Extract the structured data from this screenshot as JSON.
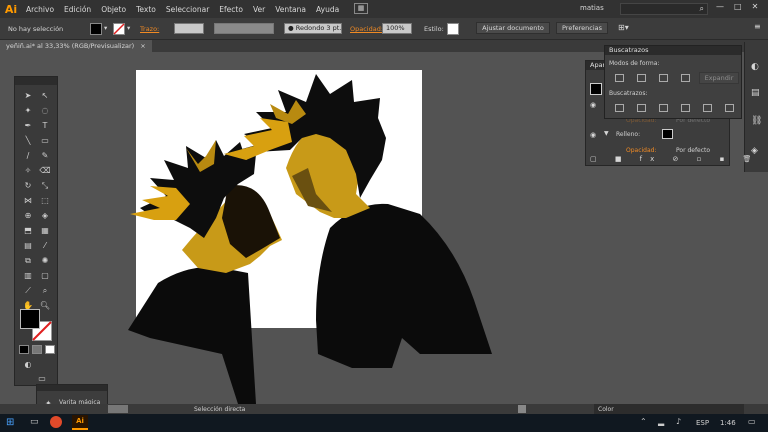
{
  "app": {
    "logo": "Ai"
  },
  "menu": [
    "Archivo",
    "Edición",
    "Objeto",
    "Texto",
    "Seleccionar",
    "Efecto",
    "Ver",
    "Ventana",
    "Ayuda"
  ],
  "user": "matias",
  "control": {
    "selection": "No hay selección",
    "stroke_label": "Trazo:",
    "brush": "Redondo 3 pt.",
    "opacity_label": "Opacidad:",
    "opacity_value": "100%",
    "style_label": "Estilo:",
    "adjust_btn": "Ajustar documento",
    "prefs_btn": "Preferencias"
  },
  "document": {
    "tab_title": "yeñiñ.ai* al 33,33% (RGB/Previsualizar)",
    "tab_close": "×"
  },
  "panels": {
    "buscatrazos": {
      "title": "Buscatrazos",
      "shape_modes": "Modos de forma:",
      "expand": "Expandir",
      "pathfinders": "Buscatrazos:"
    },
    "appearance": {
      "title": "Apari",
      "opacity": "Opacidad:",
      "default": "Por defecto",
      "fill": "Relleno:"
    },
    "color": {
      "title": "Color"
    },
    "wand": {
      "label": "Varita mágica"
    }
  },
  "status": {
    "tool": "Selección directa"
  },
  "taskbar": {
    "lang": "ESP",
    "time": "1:46",
    "ai": "Ai"
  },
  "colors": {
    "accent": "#f08a24",
    "hair_gold": "#d8a010",
    "skin": "#c89a18",
    "black": "#0b0b0b"
  }
}
